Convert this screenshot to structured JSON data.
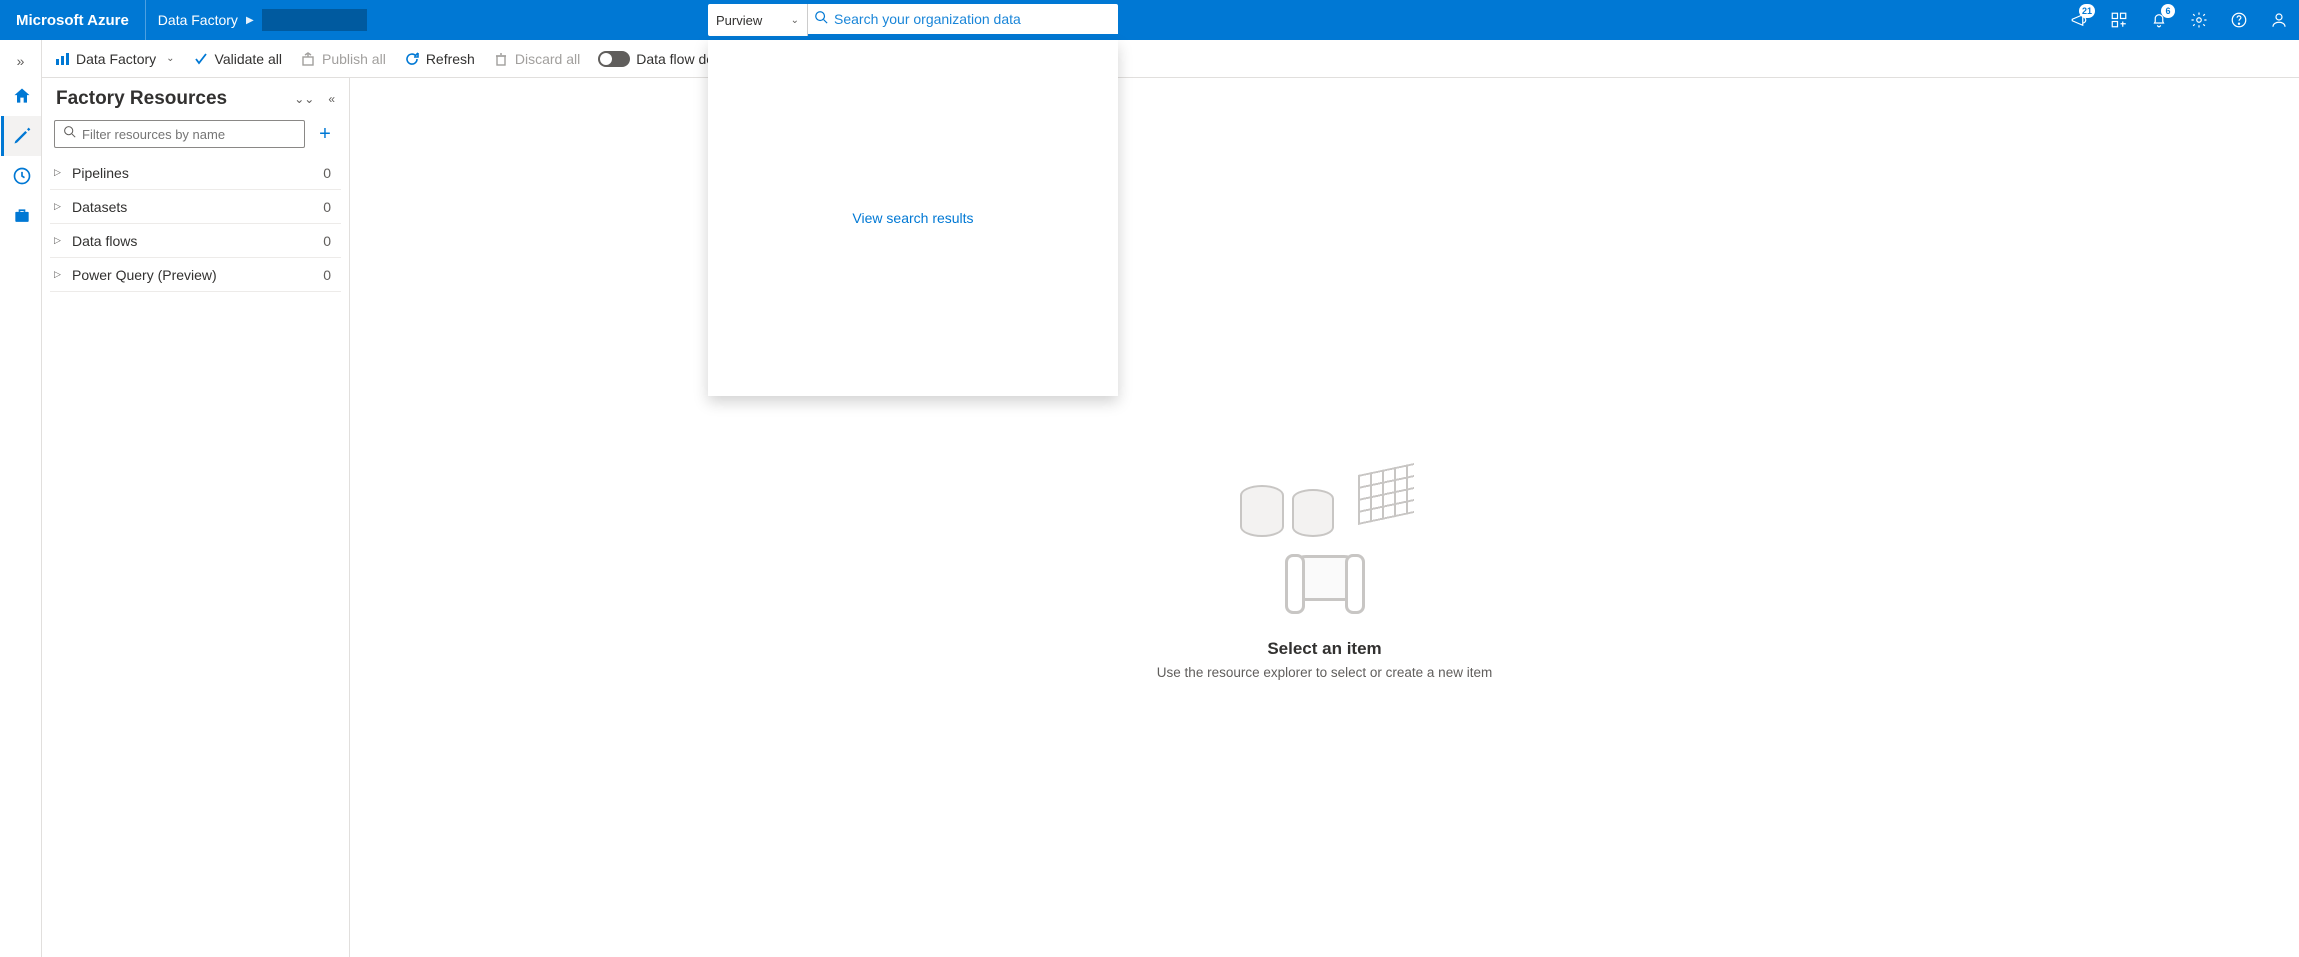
{
  "header": {
    "brand": "Microsoft Azure",
    "breadcrumb_service": "Data Factory",
    "search_scope": "Purview",
    "search_placeholder": "Search your organization data",
    "announcements_badge": "21",
    "notifications_badge": "6"
  },
  "search_dropdown": {
    "view_results": "View search results"
  },
  "command_bar": {
    "data_factory": "Data Factory",
    "validate_all": "Validate all",
    "publish_all": "Publish all",
    "refresh": "Refresh",
    "discard_all": "Discard all",
    "data_flow_debug": "Data flow debug"
  },
  "resources": {
    "title": "Factory Resources",
    "filter_placeholder": "Filter resources by name",
    "items": [
      {
        "label": "Pipelines",
        "count": "0"
      },
      {
        "label": "Datasets",
        "count": "0"
      },
      {
        "label": "Data flows",
        "count": "0"
      },
      {
        "label": "Power Query (Preview)",
        "count": "0"
      }
    ]
  },
  "empty_state": {
    "title": "Select an item",
    "subtitle": "Use the resource explorer to select or create a new item"
  }
}
